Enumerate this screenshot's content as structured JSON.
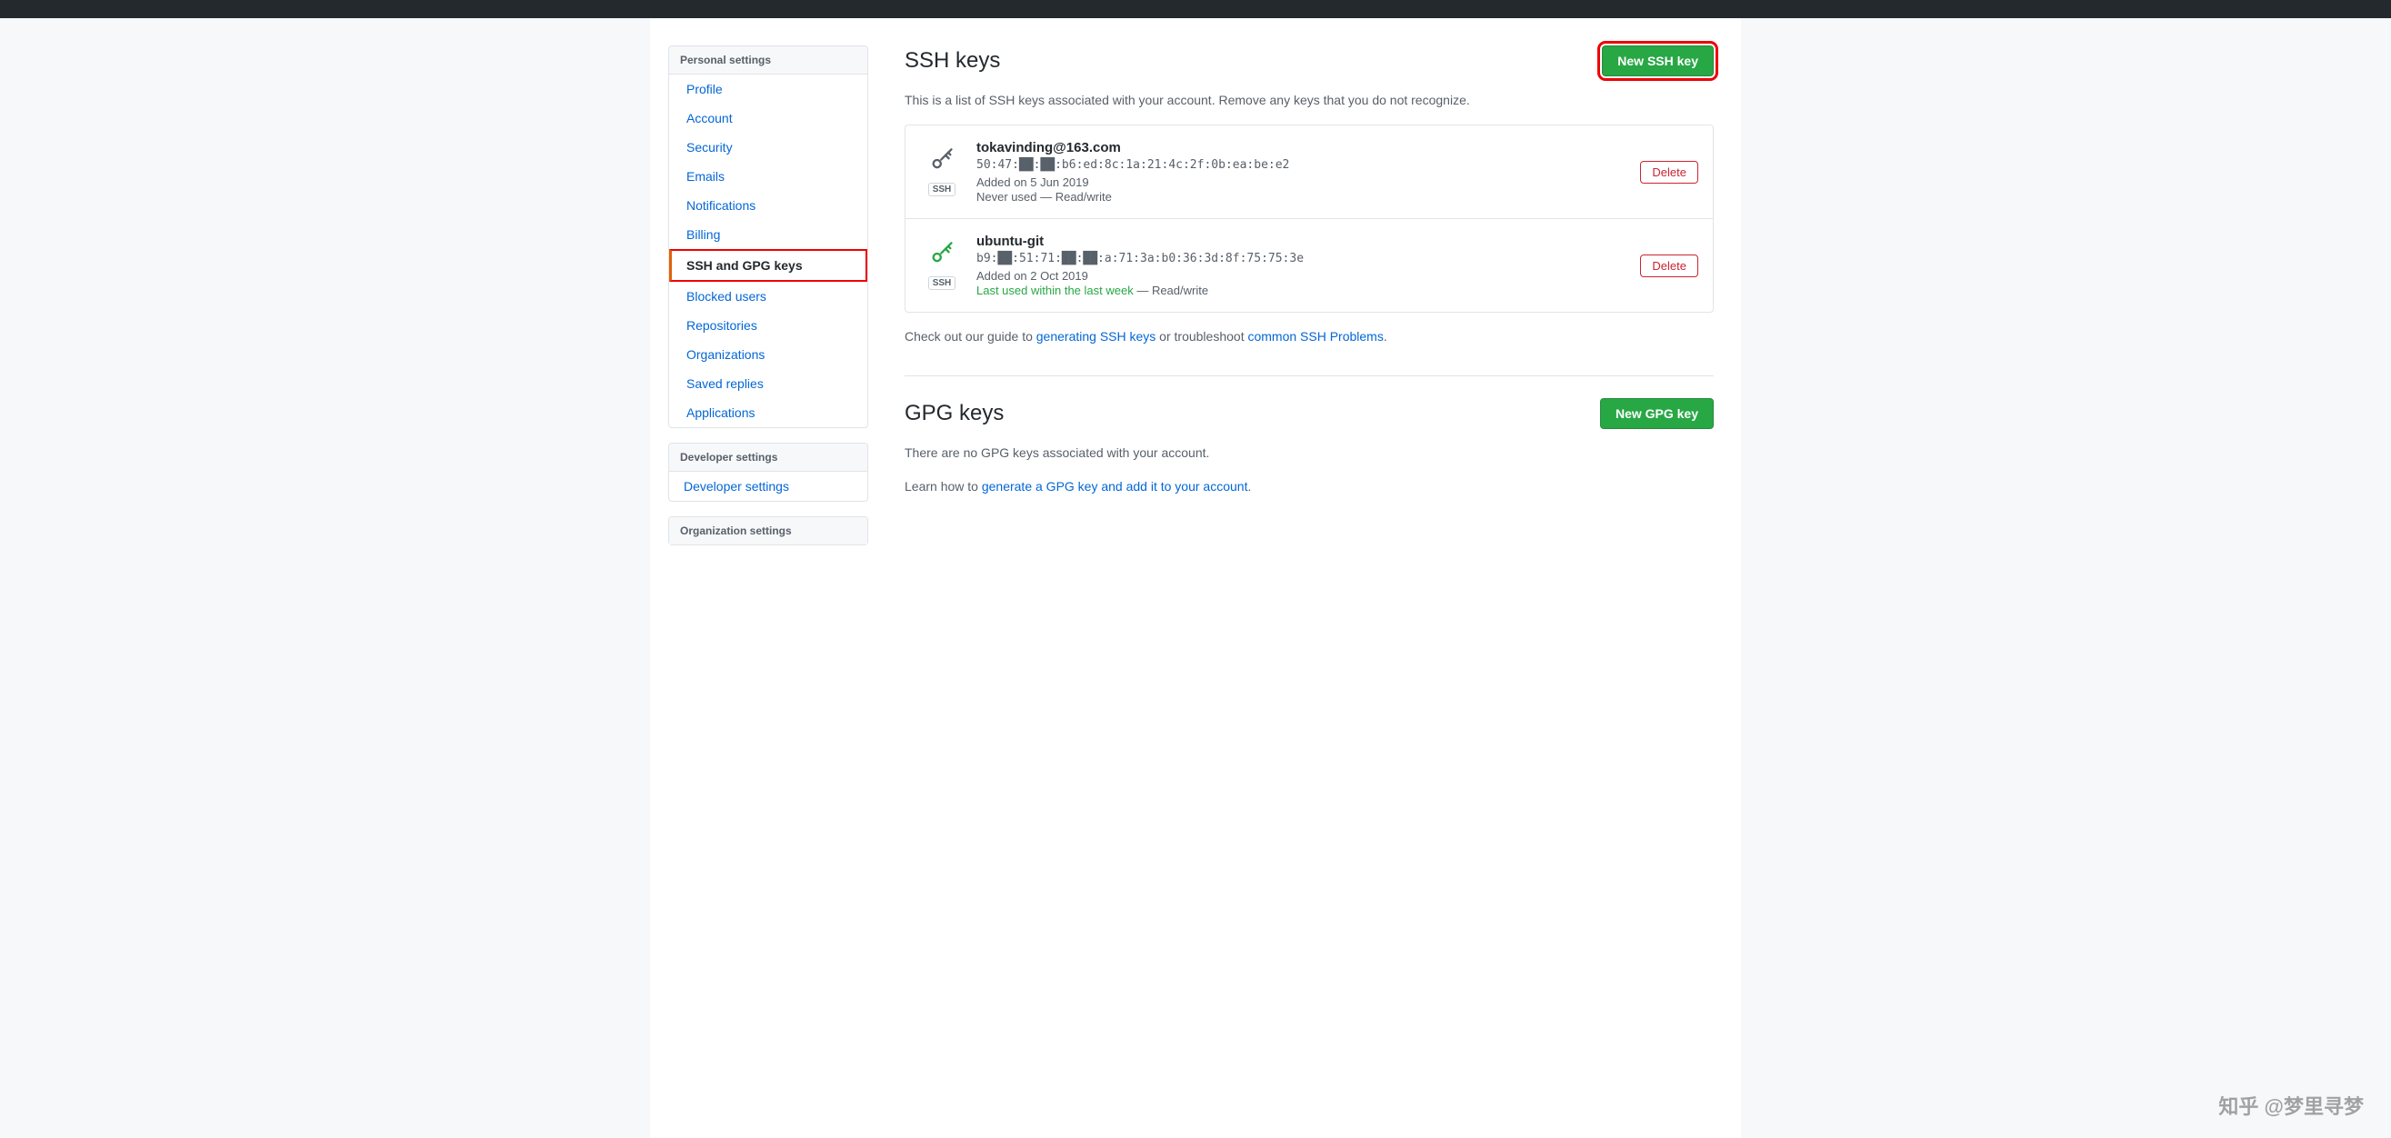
{
  "topbar": {},
  "sidebar": {
    "personal_settings_label": "Personal settings",
    "nav_items": [
      {
        "id": "profile",
        "label": "Profile",
        "active": false
      },
      {
        "id": "account",
        "label": "Account",
        "active": false
      },
      {
        "id": "security",
        "label": "Security",
        "active": false
      },
      {
        "id": "emails",
        "label": "Emails",
        "active": false
      },
      {
        "id": "notifications",
        "label": "Notifications",
        "active": false
      },
      {
        "id": "billing",
        "label": "Billing",
        "active": false
      },
      {
        "id": "ssh-gpg",
        "label": "SSH and GPG keys",
        "active": true
      },
      {
        "id": "blocked-users",
        "label": "Blocked users",
        "active": false
      },
      {
        "id": "repositories",
        "label": "Repositories",
        "active": false
      },
      {
        "id": "organizations",
        "label": "Organizations",
        "active": false
      },
      {
        "id": "saved-replies",
        "label": "Saved replies",
        "active": false
      },
      {
        "id": "applications",
        "label": "Applications",
        "active": false
      }
    ],
    "developer_settings_label": "Developer settings",
    "developer_link": "Developer settings",
    "organization_settings_label": "Organization settings"
  },
  "main": {
    "ssh_section": {
      "title": "SSH keys",
      "new_button_label": "New SSH key",
      "description": "This is a list of SSH keys associated with your account. Remove any keys that you do not recognize.",
      "keys": [
        {
          "id": "key1",
          "name": "tokavinding@163.com",
          "fingerprint": "50:47:██:██:b6:ed:8c:1a:21:4c:2f:0b:ea:be:e2",
          "added": "Added on 5 Jun 2019",
          "usage": "Never used — Read/write",
          "usage_color": "gray",
          "badge": "SSH",
          "icon_color": "gray"
        },
        {
          "id": "key2",
          "name": "ubuntu-git",
          "fingerprint": "b9:██:51:71:██:██:a:71:3a:b0:36:3d:8f:75:75:3e",
          "added": "Added on 2 Oct 2019",
          "usage": "Last used within the last week — Read/write",
          "usage_color": "green",
          "badge": "SSH",
          "icon_color": "green"
        }
      ],
      "footer_text": "Check out our guide to ",
      "footer_link1_label": "generating SSH keys",
      "footer_link1_href": "#",
      "footer_mid": " or troubleshoot ",
      "footer_link2_label": "common SSH Problems",
      "footer_link2_href": "#",
      "footer_end": ".",
      "delete_label": "Delete"
    },
    "gpg_section": {
      "title": "GPG keys",
      "new_button_label": "New GPG key",
      "no_keys_text": "There are no GPG keys associated with your account.",
      "learn_text": "Learn how to ",
      "learn_link_label": "generate a GPG key and add it to your account",
      "learn_link_href": "#",
      "learn_end": "."
    }
  },
  "watermark": "知乎 @梦里寻梦"
}
